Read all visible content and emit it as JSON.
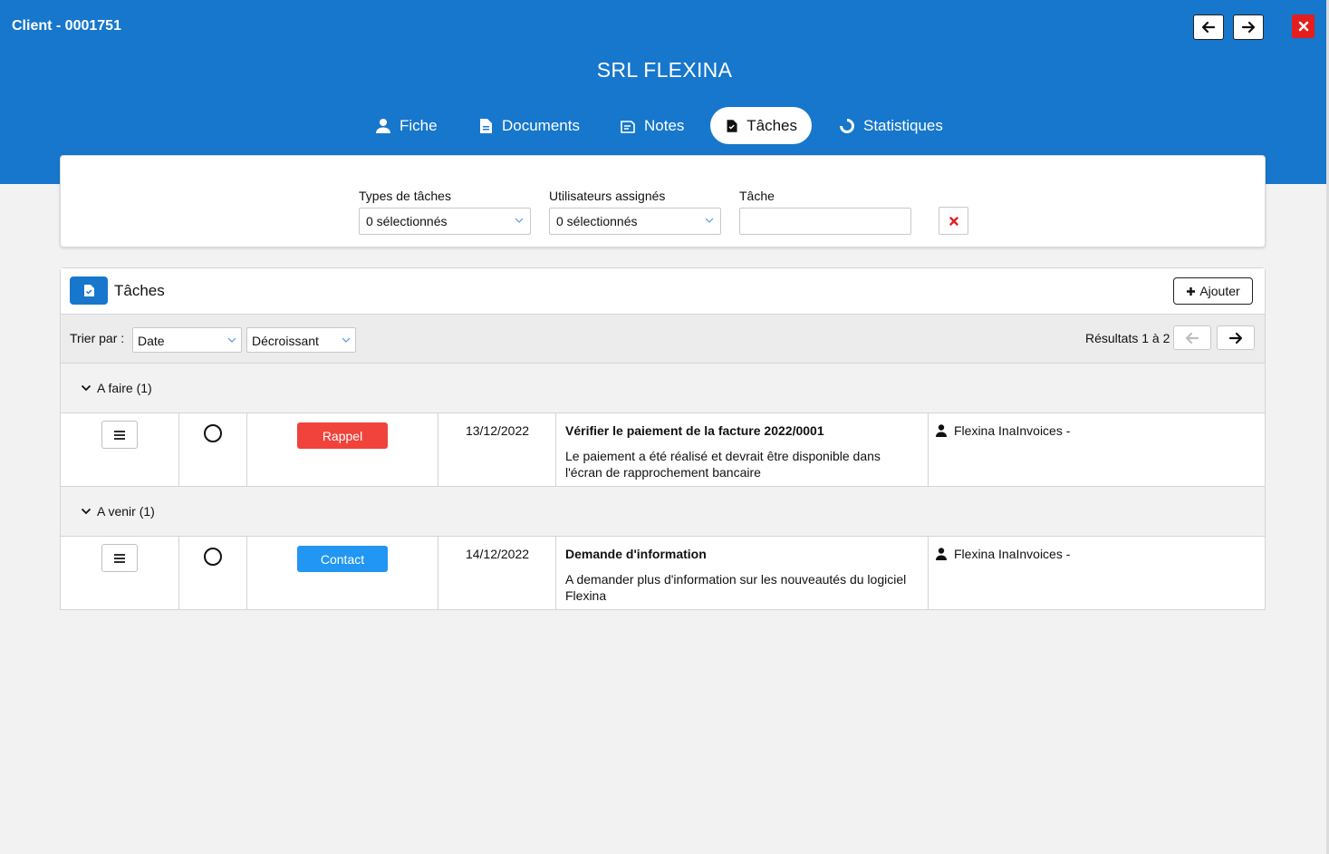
{
  "window": {
    "title": "Client - 0001751",
    "company": "SRL FLEXINA"
  },
  "tabs": [
    {
      "label": "Fiche",
      "icon": "user-icon"
    },
    {
      "label": "Documents",
      "icon": "document-icon"
    },
    {
      "label": "Notes",
      "icon": "notes-icon"
    },
    {
      "label": "Tâches",
      "icon": "task-icon",
      "active": true
    },
    {
      "label": "Statistiques",
      "icon": "stats-icon"
    }
  ],
  "filters": {
    "types_label": "Types de tâches",
    "types_value": "0 sélectionnés",
    "users_label": "Utilisateurs assignés",
    "users_value": "0 sélectionnés",
    "task_label": "Tâche",
    "task_value": ""
  },
  "panel": {
    "title": "Tâches",
    "add_label": "Ajouter",
    "sort_label": "Trier par :",
    "sort_field": "Date",
    "sort_order": "Décroissant",
    "results": "Résultats 1 à 2"
  },
  "groups": [
    {
      "label": "A faire (1)",
      "task": {
        "badge": "Rappel",
        "badge_color": "#f0433b",
        "date": "13/12/2022",
        "title": "Vérifier le paiement de la facture 2022/0001",
        "description": "Le paiement a été réalisé et devrait être disponible dans l'écran de rapprochement bancaire",
        "user": "Flexina InaInvoices -"
      }
    },
    {
      "label": "A venir (1)",
      "task": {
        "badge": "Contact",
        "badge_color": "#2196f3",
        "date": "14/12/2022",
        "title": "Demande d'information",
        "description": "A demander plus d'information sur les nouveautés du logiciel Flexina",
        "user": "Flexina InaInvoices -"
      }
    }
  ],
  "colors": {
    "brand": "#1677cc",
    "close": "#e41e1e"
  }
}
